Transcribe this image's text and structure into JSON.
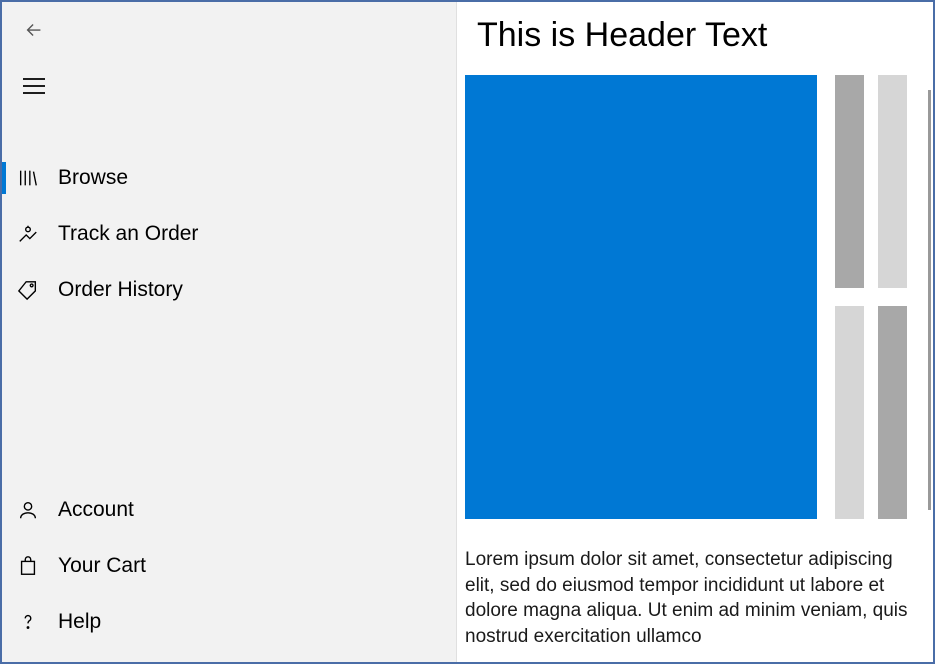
{
  "nav": {
    "top": [
      {
        "label": "Browse",
        "icon": "books-icon",
        "selected": true
      },
      {
        "label": "Track an Order",
        "icon": "track-icon",
        "selected": false
      },
      {
        "label": "Order History",
        "icon": "tag-icon",
        "selected": false
      }
    ],
    "bottom": [
      {
        "label": "Account",
        "icon": "person-icon"
      },
      {
        "label": "Your Cart",
        "icon": "bag-icon"
      },
      {
        "label": "Help",
        "icon": "question-icon"
      }
    ]
  },
  "main": {
    "header": "This is Header Text",
    "body": "Lorem ipsum dolor sit amet, consectetur adipiscing elit, sed do eiusmod tempor incididunt ut labore et dolore magna aliqua. Ut enim ad minim veniam, quis nostrud exercitation ullamco"
  }
}
